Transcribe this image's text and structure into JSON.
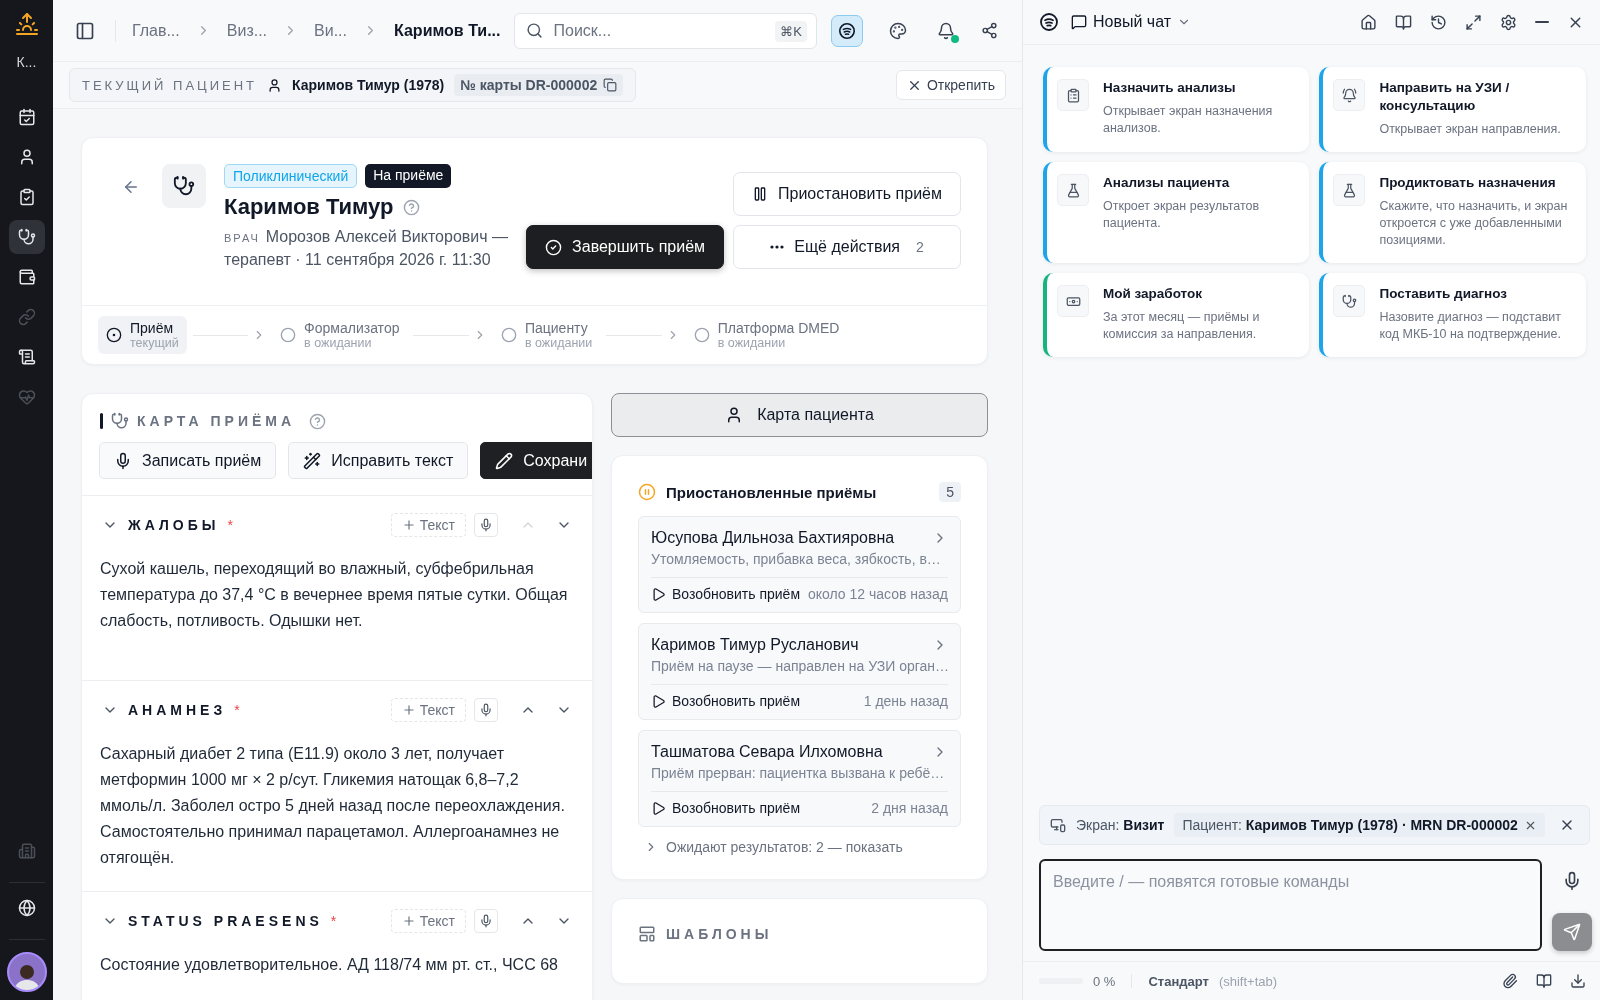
{
  "sidebar": {
    "brand_label": "К...",
    "items": [
      {
        "selected": false,
        "disabled": false
      },
      {
        "selected": false,
        "disabled": false
      },
      {
        "selected": false,
        "disabled": false
      },
      {
        "selected": true,
        "disabled": false
      },
      {
        "selected": false,
        "disabled": false
      },
      {
        "selected": false,
        "disabled": true
      },
      {
        "selected": false,
        "disabled": false
      },
      {
        "selected": false,
        "disabled": true
      }
    ],
    "bottom_items": [
      {
        "selected": false,
        "disabled": true
      },
      {
        "selected": false,
        "disabled": false
      }
    ]
  },
  "topbar": {
    "breadcrumbs": [
      {
        "label": "Глав...",
        "current": false
      },
      {
        "label": "Виз...",
        "current": false
      },
      {
        "label": "Ви...",
        "current": false
      },
      {
        "label": "Каримов Ти...",
        "current": true
      }
    ],
    "search": {
      "placeholder": "Поиск...",
      "shortcut": "⌘K"
    },
    "assistant_on": true,
    "notifications_unread": true
  },
  "patient_strip": {
    "label": "ТЕКУЩИЙ ПАЦИЕНТ",
    "name": "Каримов Тимур (1978)",
    "card_number": "№ карты DR-000002",
    "unpin": "Открепить"
  },
  "visit": {
    "tags": [
      {
        "label": "Поликлинический",
        "kind": "type"
      },
      {
        "label": "На приёме",
        "kind": "status"
      }
    ],
    "name": "Каримов Тимур",
    "doctor_label": "ВРАЧ",
    "doctor": "Морозов Алексей Викторович — терапевт · 11 сентября 2026 г. 11:30",
    "pause": "Приостановить приём",
    "finish": "Завершить приём",
    "more": "Ещё действия",
    "more_count": "2",
    "steps": [
      {
        "title": "Приём",
        "status": "текущий",
        "selected": true
      },
      {
        "title": "Формализатор",
        "status": "в ожидании",
        "selected": false
      },
      {
        "title": "Пациенту",
        "status": "в ожидании",
        "selected": false
      },
      {
        "title": "Платформа DMED",
        "status": "в ожидании",
        "selected": false
      }
    ]
  },
  "visit_card": {
    "title": "КАРТА ПРИЁМА",
    "buttons": [
      {
        "label": "Записать приём",
        "kind": "record"
      },
      {
        "label": "Исправить текст",
        "kind": "fix"
      },
      {
        "label": "Сохрани",
        "kind": "save"
      }
    ],
    "sections": [
      {
        "title": "ЖАЛОБЫ",
        "mark": "*",
        "add_label": "Текст",
        "can_move_up": false,
        "text": "Сухой кашель, переходящий во влажный, субфебрильная температура до 37,4 °C в вечернее время пятые сутки. Общая слабость, потливость. Одышки нет."
      },
      {
        "title": "АНАМНЕЗ",
        "mark": "*",
        "add_label": "Текст",
        "can_move_up": true,
        "text": "Сахарный диабет 2 типа (E11.9) около 3 лет, получает метформин 1000 мг × 2 р/сут. Гликемия натощак 6,8–7,2 ммоль/л. Заболел остро 5 дней назад после переохлаждения. Самостоятельно принимал парацетамол. Аллергоанамнез не отягощён."
      },
      {
        "title": "STATUS PRAESENS",
        "mark": "*",
        "add_label": "Текст",
        "can_move_up": true,
        "text": "Состояние удовлетворительное. АД 118/74 мм рт. ст., ЧСС 68"
      }
    ]
  },
  "patient_card_button": "Карта пациента",
  "paused": {
    "title": "Приостановленные приёмы",
    "count": "5",
    "items": [
      {
        "name": "Юсупова Дильноза Бахтияровна",
        "note": "Утомляемость, прибавка веса, зябкость, в…",
        "action": "Возобновить приём",
        "time": "около 12 часов назад"
      },
      {
        "name": "Каримов Тимур Русланович",
        "note": "Приём на паузе — направлен на УЗИ орган…",
        "action": "Возобновить приём",
        "time": "1 день назад"
      },
      {
        "name": "Ташматова Севара Илхомовна",
        "note": "Приём прерван: пациентка вызвана к ребё…",
        "action": "Возобновить приём",
        "time": "2 дня назад"
      }
    ],
    "footer": "Ожидают результатов: 2 — показать"
  },
  "templates": {
    "title": "ШАБЛОНЫ"
  },
  "chat": {
    "title": "Новый чат",
    "quick_actions": [
      {
        "title": "Назначить анализы",
        "description": "Открывает экран назначения анализов.",
        "color": "#1ea5e9"
      },
      {
        "title": "Направить на УЗИ / консультацию",
        "description": "Открывает экран направления.",
        "color": "#1ea5e9"
      },
      {
        "title": "Анализы пациента",
        "description": "Откроет экран результатов пациента.",
        "color": "#1ea5e9"
      },
      {
        "title": "Продиктовать назначения",
        "description": "Скажите, что назначить, и экран откроется с уже добавленными позициями.",
        "color": "#1ea5e9"
      },
      {
        "title": "Мой заработок",
        "description": "За этот месяц — приёмы и комиссия за направления.",
        "color": "#16b57f"
      },
      {
        "title": "Поставить диагноз",
        "description": "Назовите диагноз — подставит код МКБ-10 на подтверждение.",
        "color": "#1ea5e9"
      }
    ],
    "context": {
      "screen_label": "Экран:",
      "screen": "Визит",
      "patient_label": "Пациент:",
      "patient": "Каримов Тимур (1978) · MRN DR-000002"
    },
    "input": {
      "placeholder": "Введите / — появятся готовые команды"
    },
    "footer": {
      "level": 0,
      "percent": "0 %",
      "mode": "Стандарт",
      "hint": "(shift+tab)"
    }
  }
}
